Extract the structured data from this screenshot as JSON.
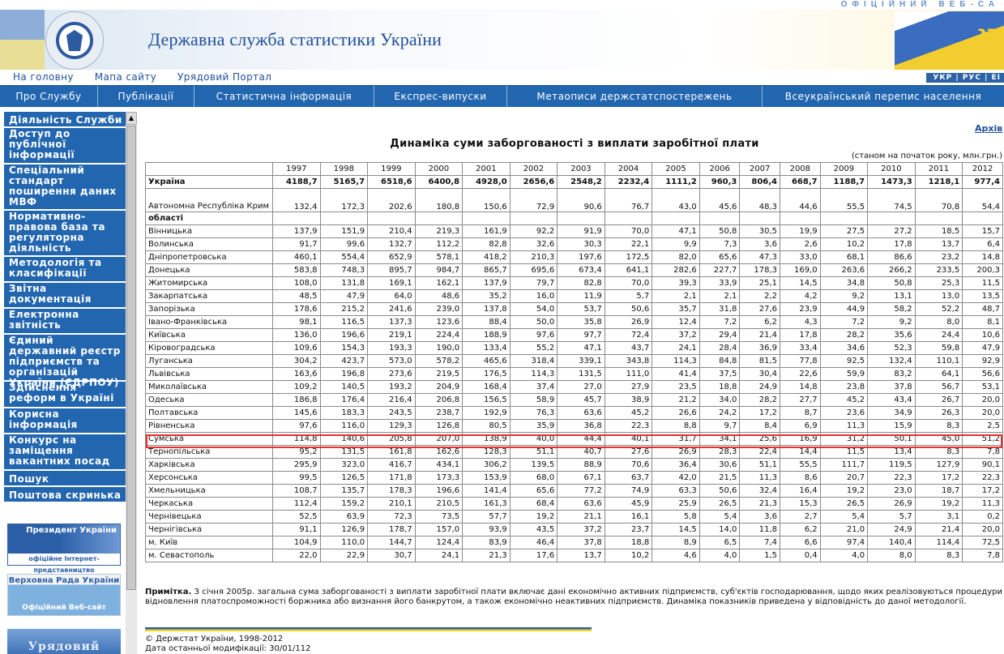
{
  "header": {
    "title": "Державна служба статистики України",
    "official": "ОФІЦІЙНИЙ ВЕБ-СА",
    "lang": "УКР | РУС | ЕІ",
    "top_links": [
      "На головну",
      "Мапа сайту",
      "Урядовий Портал"
    ]
  },
  "nav": [
    "Про Службу",
    "Публікації",
    "Статистична інформація",
    "Експрес-випуски",
    "Метаописи держстатспостережень",
    "Всеукраїнський перепис населення"
  ],
  "sidebar": [
    "Діяльність Служби",
    "Доступ до публічної інформації",
    "Спеціальний стандарт поширення даних МВФ",
    "Нормативно-правова база та регуляторна діяльність",
    "Методологія та класифікації",
    "Звітна документація",
    "Електронна звітність",
    "Єдиний державний реєстр підприємств та організацій України (ЄДРПОУ)",
    "Здійснення реформ в Україні",
    "Корисна інформація",
    "Конкурс на заміщення вакантних посад",
    "Пошук",
    "Поштова скринька"
  ],
  "banners": {
    "president": {
      "title": "Президент України",
      "sub": "офіційне Інтернет-представництво"
    },
    "rada": {
      "title": "Верховна Рада України",
      "sub": "Офіційний Веб-сайт"
    },
    "gov": {
      "title": "Урядовий"
    }
  },
  "content": {
    "archive": "Архів",
    "title": "Динаміка суми заборгованості з виплати заробітної плати",
    "subtitle": "(станом на початок року, млн.грн.)",
    "years": [
      "1997",
      "1998",
      "1999",
      "2000",
      "2001",
      "2002",
      "2003",
      "2004",
      "2005",
      "2006",
      "2007",
      "2008",
      "2009",
      "2010",
      "2011",
      "2012"
    ],
    "rows": [
      {
        "name": "Україна",
        "bold": true,
        "v": [
          "4188,7",
          "5165,7",
          "6518,6",
          "6400,8",
          "4928,0",
          "2656,6",
          "2548,2",
          "2232,4",
          "1111,2",
          "960,3",
          "806,4",
          "668,7",
          "1188,7",
          "1473,3",
          "1218,1",
          "977,4"
        ]
      },
      {
        "name": "Автономна Республіка Крим",
        "tall": true,
        "v": [
          "132,4",
          "172,3",
          "202,6",
          "180,8",
          "150,6",
          "72,9",
          "90,6",
          "76,7",
          "43,0",
          "45,6",
          "48,3",
          "44,6",
          "55,5",
          "74,5",
          "70,8",
          "54,4"
        ]
      },
      {
        "name": "області",
        "bold": true,
        "v": [
          "",
          "",
          "",
          "",
          "",
          "",
          "",
          "",
          "",
          "",
          "",
          "",
          "",
          "",
          "",
          ""
        ]
      },
      {
        "name": "Вінницька",
        "v": [
          "137,9",
          "151,9",
          "210,4",
          "219,3",
          "161,9",
          "92,2",
          "91,9",
          "70,0",
          "47,1",
          "50,8",
          "30,5",
          "19,9",
          "27,5",
          "27,2",
          "18,5",
          "15,7"
        ]
      },
      {
        "name": "Волинська",
        "v": [
          "91,7",
          "99,6",
          "132,7",
          "112,2",
          "82,8",
          "32,6",
          "30,3",
          "22,1",
          "9,9",
          "7,3",
          "3,6",
          "2,6",
          "10,2",
          "17,8",
          "13,7",
          "6,4"
        ]
      },
      {
        "name": "Дніпропетровська",
        "v": [
          "460,1",
          "554,4",
          "652,9",
          "578,1",
          "418,2",
          "210,3",
          "197,6",
          "172,5",
          "82,0",
          "65,6",
          "47,3",
          "33,0",
          "68,1",
          "86,6",
          "23,2",
          "14,8"
        ]
      },
      {
        "name": "Донецька",
        "v": [
          "583,8",
          "748,3",
          "895,7",
          "984,7",
          "865,7",
          "695,6",
          "673,4",
          "641,1",
          "282,6",
          "227,7",
          "178,3",
          "169,0",
          "263,6",
          "266,2",
          "233,5",
          "200,3"
        ]
      },
      {
        "name": "Житомирська",
        "v": [
          "108,0",
          "131,8",
          "169,1",
          "162,1",
          "137,9",
          "79,7",
          "82,8",
          "70,0",
          "39,3",
          "33,9",
          "25,1",
          "14,5",
          "34,8",
          "50,8",
          "25,3",
          "11,5"
        ]
      },
      {
        "name": "Закарпатська",
        "v": [
          "48,5",
          "47,9",
          "64,0",
          "48,6",
          "35,2",
          "16,0",
          "11,9",
          "5,7",
          "2,1",
          "2,1",
          "2,2",
          "4,2",
          "9,2",
          "13,1",
          "13,0",
          "13,5"
        ]
      },
      {
        "name": "Запорізька",
        "v": [
          "178,6",
          "215,2",
          "241,6",
          "239,0",
          "137,8",
          "54,0",
          "53,7",
          "50,6",
          "35,7",
          "31,8",
          "27,6",
          "23,9",
          "44,9",
          "58,2",
          "52,2",
          "48,7"
        ]
      },
      {
        "name": "Івано-Франківська",
        "v": [
          "98,1",
          "116,5",
          "137,3",
          "123,6",
          "88,4",
          "50,0",
          "35,8",
          "26,9",
          "12,4",
          "7,2",
          "6,2",
          "4,3",
          "7,2",
          "9,2",
          "8,0",
          "8,1"
        ]
      },
      {
        "name": "Київська",
        "v": [
          "136,0",
          "196,6",
          "219,1",
          "224,4",
          "188,9",
          "97,6",
          "97,7",
          "72,4",
          "37,2",
          "29,4",
          "21,4",
          "17,8",
          "28,2",
          "35,6",
          "24,4",
          "10,6"
        ]
      },
      {
        "name": "Кіровоградська",
        "v": [
          "109,6",
          "154,3",
          "193,3",
          "190,0",
          "133,4",
          "55,2",
          "47,1",
          "43,7",
          "24,1",
          "28,4",
          "36,9",
          "33,4",
          "34,6",
          "52,3",
          "59,8",
          "47,9"
        ]
      },
      {
        "name": "Луганська",
        "v": [
          "304,2",
          "423,7",
          "573,0",
          "578,2",
          "465,6",
          "318,4",
          "339,1",
          "343,8",
          "114,3",
          "84,8",
          "81,5",
          "77,8",
          "92,5",
          "132,4",
          "110,1",
          "92,9"
        ]
      },
      {
        "name": "Львівська",
        "v": [
          "163,6",
          "196,8",
          "273,6",
          "219,5",
          "176,5",
          "114,3",
          "131,5",
          "111,0",
          "41,4",
          "37,5",
          "30,4",
          "22,6",
          "59,9",
          "83,2",
          "64,1",
          "56,6"
        ]
      },
      {
        "name": "Миколаївська",
        "v": [
          "109,2",
          "140,5",
          "193,2",
          "204,9",
          "168,4",
          "37,4",
          "27,0",
          "27,9",
          "23,5",
          "18,8",
          "24,9",
          "14,8",
          "23,8",
          "37,8",
          "56,7",
          "53,1"
        ]
      },
      {
        "name": "Одеська",
        "v": [
          "186,8",
          "176,4",
          "216,4",
          "206,8",
          "156,5",
          "58,9",
          "45,7",
          "38,9",
          "21,2",
          "34,0",
          "28,2",
          "27,7",
          "45,2",
          "43,4",
          "26,7",
          "20,0"
        ]
      },
      {
        "name": "Полтавська",
        "v": [
          "145,6",
          "183,3",
          "243,5",
          "238,7",
          "192,9",
          "76,3",
          "63,6",
          "45,2",
          "26,6",
          "24,2",
          "17,2",
          "8,7",
          "23,6",
          "34,9",
          "26,3",
          "20,0"
        ]
      },
      {
        "name": "Рівненська",
        "v": [
          "97,6",
          "116,0",
          "129,3",
          "126,8",
          "80,5",
          "35,9",
          "36,8",
          "22,3",
          "8,8",
          "9,7",
          "8,4",
          "6,9",
          "11,3",
          "15,9",
          "8,3",
          "2,5"
        ]
      },
      {
        "name": "Сумська",
        "v": [
          "114,8",
          "140,6",
          "205,8",
          "207,0",
          "138,9",
          "40,0",
          "44,4",
          "40,1",
          "31,7",
          "34,1",
          "25,6",
          "16,9",
          "31,2",
          "50,1",
          "45,0",
          "51,2"
        ]
      },
      {
        "name": "Тернопільська",
        "v": [
          "95,2",
          "131,5",
          "161,8",
          "162,6",
          "128,3",
          "51,1",
          "40,7",
          "27,6",
          "26,9",
          "28,3",
          "22,4",
          "14,4",
          "11,5",
          "13,4",
          "8,3",
          "7,8"
        ]
      },
      {
        "name": "Харківська",
        "v": [
          "295,9",
          "323,0",
          "416,7",
          "434,1",
          "306,2",
          "139,5",
          "88,9",
          "70,6",
          "36,4",
          "30,6",
          "51,1",
          "55,5",
          "111,7",
          "119,5",
          "127,9",
          "90,1"
        ]
      },
      {
        "name": "Херсонська",
        "v": [
          "99,5",
          "126,5",
          "171,8",
          "173,3",
          "153,9",
          "68,0",
          "67,1",
          "63,7",
          "42,0",
          "21,5",
          "11,3",
          "8,6",
          "20,7",
          "22,3",
          "17,2",
          "22,3"
        ]
      },
      {
        "name": "Хмельницька",
        "v": [
          "108,7",
          "135,7",
          "178,3",
          "196,6",
          "141,4",
          "65,6",
          "77,2",
          "74,9",
          "63,3",
          "50,6",
          "32,4",
          "16,4",
          "19,2",
          "23,0",
          "18,7",
          "17,2"
        ]
      },
      {
        "name": "Черкаська",
        "v": [
          "112,4",
          "159,2",
          "210,1",
          "210,5",
          "161,3",
          "68,4",
          "63,6",
          "45,9",
          "25,9",
          "26,5",
          "21,3",
          "15,3",
          "26,5",
          "26,9",
          "19,2",
          "11,3"
        ]
      },
      {
        "name": "Чернівецька",
        "v": [
          "52,5",
          "63,9",
          "72,3",
          "73,5",
          "57,7",
          "19,2",
          "21,1",
          "16,1",
          "5,8",
          "5,4",
          "3,6",
          "2,7",
          "5,4",
          "5,7",
          "3,1",
          "0,2"
        ]
      },
      {
        "name": "Чернігівська",
        "v": [
          "91,1",
          "126,9",
          "178,7",
          "157,0",
          "93,9",
          "43,5",
          "37,2",
          "23,7",
          "14,5",
          "14,0",
          "11,8",
          "6,2",
          "21,0",
          "24,9",
          "21,4",
          "20,0"
        ]
      },
      {
        "name": "м. Київ",
        "v": [
          "104,9",
          "110,0",
          "144,7",
          "124,4",
          "83,9",
          "46,4",
          "37,8",
          "18,8",
          "8,9",
          "6,5",
          "7,4",
          "6,6",
          "97,4",
          "140,4",
          "114,4",
          "72,5"
        ]
      },
      {
        "name": "м. Севастополь",
        "v": [
          "22,0",
          "22,9",
          "30,7",
          "24,1",
          "21,3",
          "17,6",
          "13,7",
          "10,2",
          "4,6",
          "4,0",
          "1,5",
          "0,4",
          "4,0",
          "8,0",
          "8,3",
          "7,8"
        ]
      }
    ],
    "note_label": "Примітка.",
    "note": " З січня 2005р. загальна сума заборгованості з виплати заробітної плати включає дані економічно активних підприємств, суб'єктів господарювання, щодо яких реалізовуються процедури відновлення платоспроможності боржника або визнання його банкрутом, а також економічно неактивних підприємств. Динаміка показників приведена у відповідність до даної методології."
  },
  "footer": {
    "copyright": "© Держстат України, 1998-2012",
    "modified": "Дата останньої модифікації: 30/01/112"
  }
}
